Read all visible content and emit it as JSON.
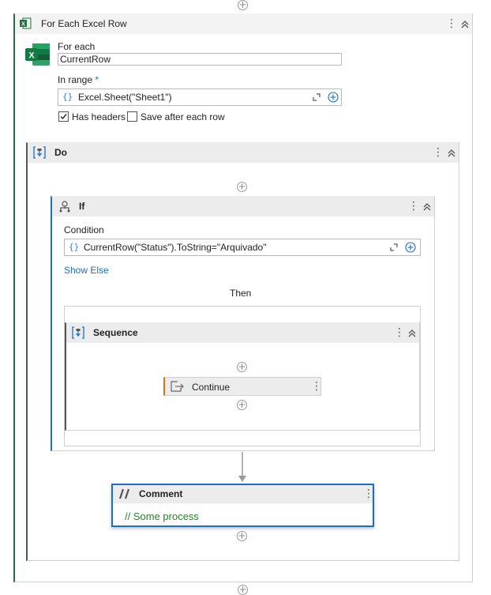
{
  "for_each_row": {
    "title": "For Each Excel Row",
    "for_each_label": "For each",
    "for_each_value": "CurrentRow",
    "in_range_label": "In range",
    "in_range_required": "*",
    "in_range_value": "Excel.Sheet(\"Sheet1\")",
    "braces": "{}",
    "has_headers_label": "Has headers",
    "has_headers_checked": true,
    "save_after_label": "Save after each row",
    "save_after_checked": false
  },
  "do_block": {
    "title": "Do"
  },
  "if_block": {
    "title": "If",
    "condition_label": "Condition",
    "braces": "{}",
    "condition_value": "CurrentRow(\"Status\").ToString=\"Arquivado\"",
    "show_else": "Show Else",
    "then_label": "Then"
  },
  "sequence": {
    "title": "Sequence"
  },
  "continue_activity": {
    "title": "Continue"
  },
  "comment": {
    "title": "Comment",
    "text": "// Some process"
  },
  "colors": {
    "accent_green": "#217346",
    "accent_blue": "#1a6fc7",
    "selected_border": "#1a6fc7",
    "continue_accent": "#d97706",
    "comment_text": "#1f8a1f"
  },
  "icons": [
    "excel-icon",
    "sequence-icon",
    "if-icon",
    "continue-icon",
    "comment-icon",
    "kebab-icon",
    "collapse-icon",
    "add-icon",
    "expand-icon"
  ]
}
